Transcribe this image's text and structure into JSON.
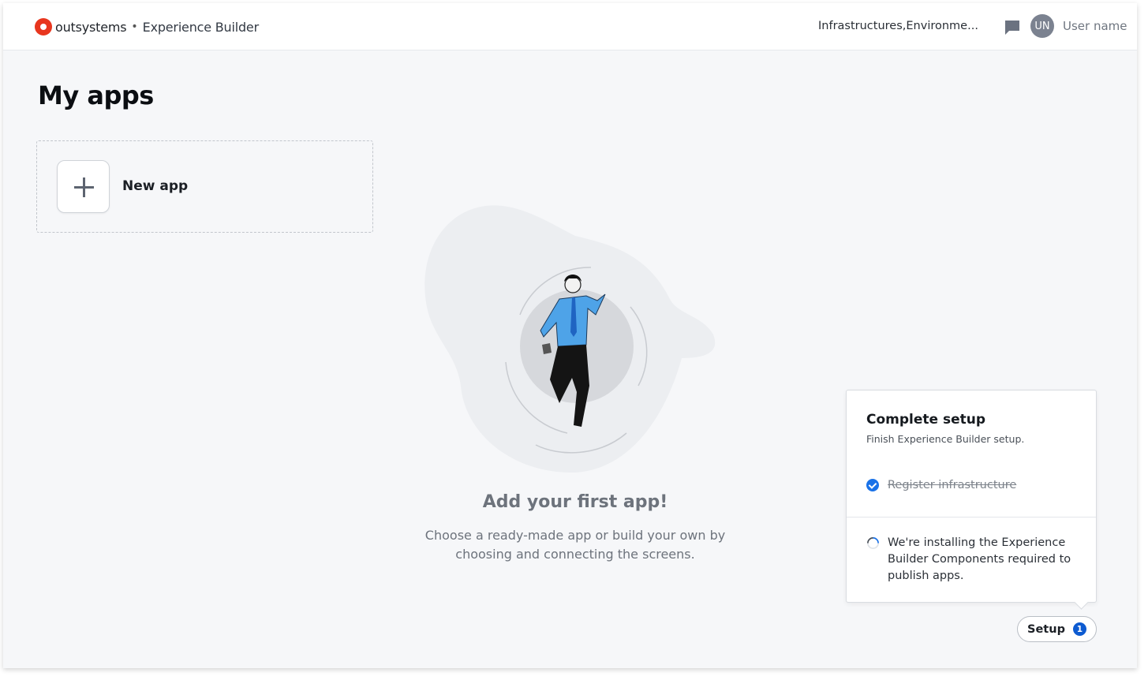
{
  "header": {
    "brand": "outsystems",
    "separator": "•",
    "product": "Experience Builder",
    "environment": "Infrastructures,Environme...",
    "avatar_initials": "UN",
    "username": "User name"
  },
  "main": {
    "title": "My apps",
    "new_app_label": "New app",
    "empty_title": "Add your first app!",
    "empty_subtitle": "Choose a ready-made app or build your own by choosing and connecting the screens."
  },
  "setup_panel": {
    "title": "Complete setup",
    "subtitle": "Finish Experience Builder setup.",
    "steps": [
      {
        "label": "Register infrastructure",
        "status": "done"
      },
      {
        "label": "We're installing the Experience Builder Components required to publish apps.",
        "status": "in-progress"
      }
    ]
  },
  "setup_button": {
    "label": "Setup",
    "badge": "1"
  },
  "colors": {
    "brand_red": "#e8361e",
    "accent_blue": "#1a72e8",
    "badge_blue": "#0d5bd1",
    "background": "#f6f7f9"
  },
  "icons": [
    "outsystems-logo-icon",
    "chat-icon",
    "plus-icon",
    "check-circle-icon",
    "spinner-icon"
  ]
}
